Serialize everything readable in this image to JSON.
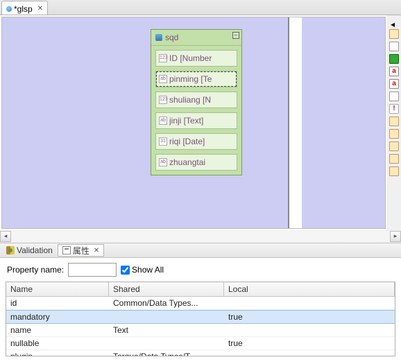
{
  "top_tab": {
    "label": "*glsp",
    "close": "✕"
  },
  "entity": {
    "title": "sqd",
    "rows": [
      {
        "icon": "123",
        "label": "ID [Number",
        "selected": false
      },
      {
        "icon": "ab",
        "label": "pinming [Te",
        "selected": true
      },
      {
        "icon": "123",
        "label": "shuliang [N",
        "selected": false
      },
      {
        "icon": "ab",
        "label": "jinji [Text]",
        "selected": false
      },
      {
        "icon": "31",
        "label": "riqi [Date]",
        "selected": false
      },
      {
        "icon": "ab",
        "label": "zhuangtai",
        "selected": false
      }
    ]
  },
  "bottom_tabs": {
    "validation": "Validation",
    "properties": "属性",
    "close": "✕"
  },
  "props_bar": {
    "label": "Property name:",
    "value": "",
    "show_all_label": "Show All",
    "show_all_checked": true
  },
  "props_table": {
    "headers": {
      "name": "Name",
      "shared": "Shared",
      "local": "Local"
    },
    "rows": [
      {
        "name": "id",
        "shared": "Common/Data Types...",
        "local": "",
        "selected": false
      },
      {
        "name": "mandatory",
        "shared": "",
        "local": "true",
        "selected": true
      },
      {
        "name": "name",
        "shared": "Text",
        "local": "",
        "selected": false
      },
      {
        "name": "nullable",
        "shared": "",
        "local": "true",
        "selected": false
      },
      {
        "name": "plugin",
        "shared": "Torque/Data Types/T",
        "local": "",
        "selected": false
      }
    ]
  }
}
